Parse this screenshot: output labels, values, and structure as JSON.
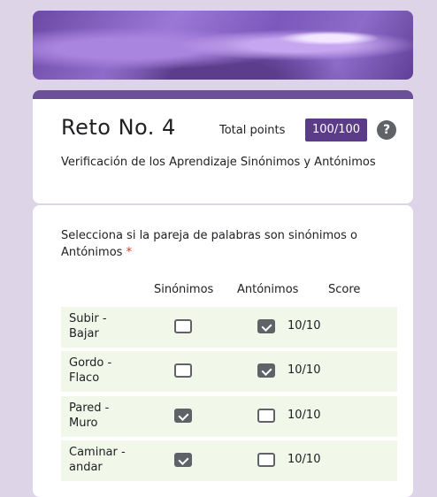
{
  "form": {
    "title": "Reto No. 4",
    "total_points_label": "Total points",
    "points": "100/100",
    "help_icon": "?",
    "description": "Verificación de los Aprendizaje Sinónimos y Antónimos"
  },
  "question": {
    "text": "Selecciona si la pareja de palabras son sinónimos o Antónimos",
    "required_mark": "*",
    "columns": [
      "Sinónimos",
      "Antónimos",
      "Score"
    ],
    "rows": [
      {
        "label": "Subir - Bajar",
        "sinonimos": false,
        "antonimos": true,
        "score": "10/10"
      },
      {
        "label": "Gordo - Flaco",
        "sinonimos": false,
        "antonimos": true,
        "score": "10/10"
      },
      {
        "label": "Pared - Muro",
        "sinonimos": true,
        "antonimos": false,
        "score": "10/10"
      },
      {
        "label": "Caminar - andar",
        "sinonimos": true,
        "antonimos": false,
        "score": "10/10"
      }
    ]
  }
}
